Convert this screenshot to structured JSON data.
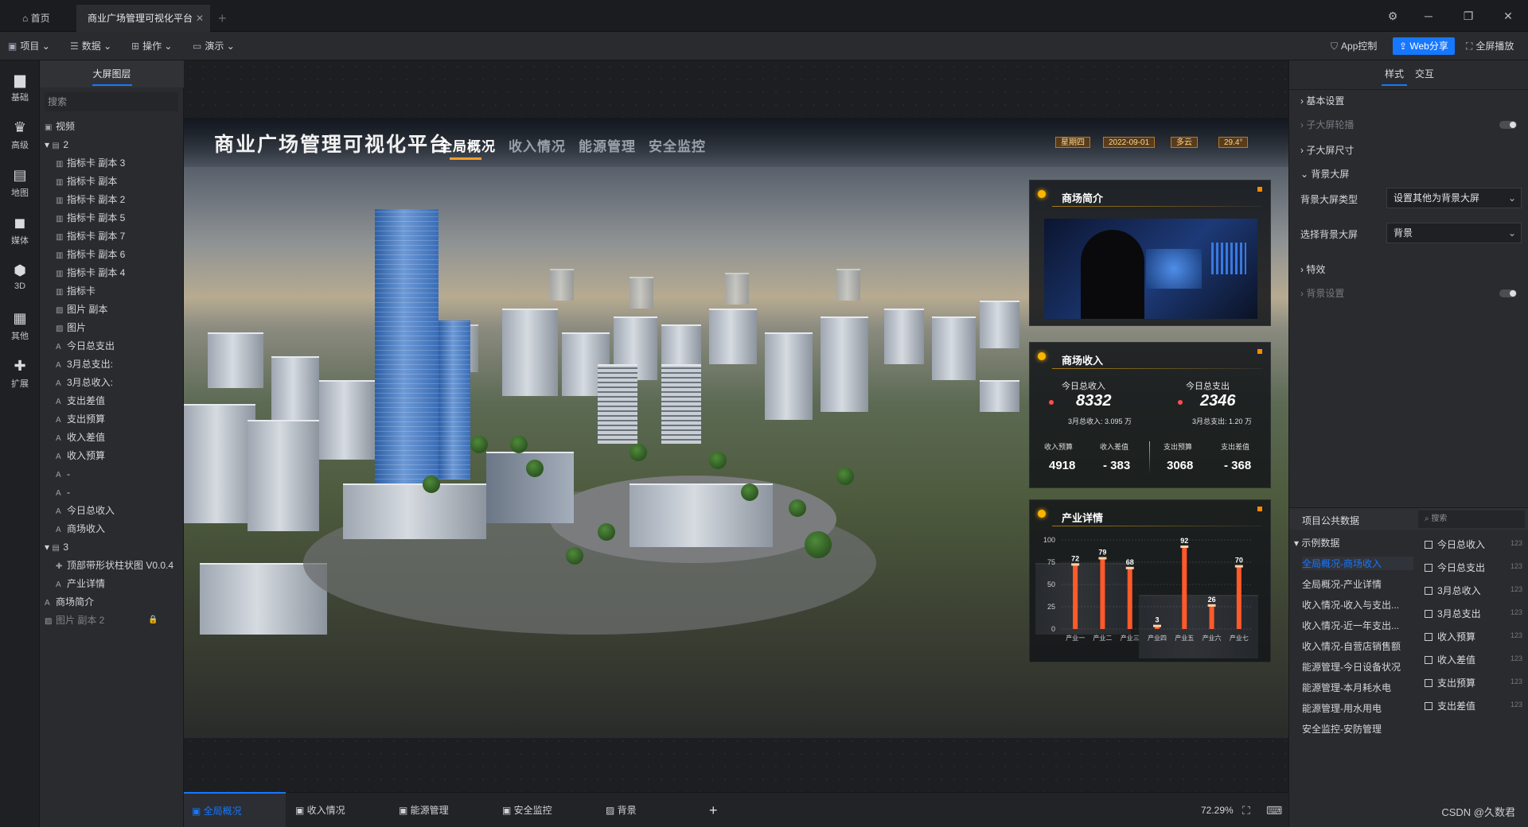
{
  "tabs": {
    "home": "首页",
    "active": "商业广场管理可视化平台"
  },
  "toolbar": {
    "menus": [
      "项目",
      "数据",
      "操作",
      "演示"
    ],
    "app_control": "App控制",
    "web_share": "Web分享",
    "fullscreen": "全屏播放",
    "accent_color": "#1677ff"
  },
  "rail": [
    "基础",
    "高级",
    "地图",
    "媒体",
    "3D",
    "其他",
    "扩展"
  ],
  "layers": {
    "title": "大屏图层",
    "search_placeholder": "搜索",
    "items": [
      "视频",
      "2",
      "指标卡 副本 3",
      "指标卡 副本",
      "指标卡 副本 2",
      "指标卡 副本 5",
      "指标卡 副本 7",
      "指标卡 副本 6",
      "指标卡 副本 4",
      "指标卡",
      "图片 副本",
      "图片",
      "今日总支出",
      "3月总支出:",
      "3月总收入:",
      "支出差值",
      "支出预算",
      "收入差值",
      "收入预算",
      "-",
      "-",
      "今日总收入",
      "商场收入",
      "3",
      "顶部带形状柱状图 V0.0.4",
      "产业详情",
      "商场简介",
      "图片 副本 2"
    ]
  },
  "screen": {
    "title": "商业广场管理可视化平台",
    "nav": [
      "全局概况",
      "收入情况",
      "能源管理",
      "安全监控"
    ],
    "badges": [
      "星期四",
      "2022-09-01",
      "多云",
      "29.4°"
    ]
  },
  "intro_panel": {
    "title": "商场简介"
  },
  "income_panel": {
    "title": "商场收入",
    "today_income_label": "今日总收入",
    "today_income": "8332",
    "month_income": "3月总收入: 3.095 万",
    "today_expense_label": "今日总支出",
    "today_expense": "2346",
    "month_expense": "3月总支出: 1.20 万",
    "kpis": [
      {
        "label": "收入预算",
        "value": "4918"
      },
      {
        "label": "收入差值",
        "value": "383"
      },
      {
        "label": "支出预算",
        "value": "3068"
      },
      {
        "label": "支出差值",
        "value": "368"
      }
    ]
  },
  "chart_data": {
    "type": "bar",
    "title": "产业详情",
    "categories": [
      "产业一",
      "产业二",
      "产业三",
      "产业四",
      "产业五",
      "产业六",
      "产业七"
    ],
    "values": [
      72,
      79,
      68,
      3,
      92,
      26,
      70
    ],
    "ylim": [
      0,
      100
    ],
    "yticks": [
      0,
      25,
      50,
      75,
      100
    ],
    "colors": {
      "bar": "#ff5a2a",
      "label": "#ffffff"
    }
  },
  "props": {
    "tabs": [
      "样式",
      "交互"
    ],
    "rows": [
      "基本设置",
      "子大屏轮播",
      "子大屏尺寸",
      "背景大屏",
      "背景大屏类型",
      "选择背景大屏",
      "特效",
      "背景设置"
    ],
    "bg_type_value": "设置其他为背景大屏",
    "bg_select_value": "背景",
    "data_title": "项目公共数据",
    "data_search_placeholder": "搜索",
    "data_tree": [
      "示例数据",
      "全局概况-商场收入",
      "全局概况-产业详情",
      "收入情况-收入与支出...",
      "收入情况-近一年支出...",
      "收入情况-自营店销售额",
      "能源管理-今日设备状况",
      "能源管理-本月耗水电",
      "能源管理-用水用电",
      "安全监控-安防管理"
    ],
    "fields": [
      "今日总收入",
      "今日总支出",
      "3月总收入",
      "3月总支出",
      "收入预算",
      "收入差值",
      "支出预算",
      "支出差值"
    ],
    "field_type": "123"
  },
  "pages": {
    "items": [
      "全局概况",
      "收入情况",
      "能源管理",
      "安全监控",
      "背景"
    ],
    "zoom": "72.29%"
  },
  "watermark": "CSDN @久数君"
}
